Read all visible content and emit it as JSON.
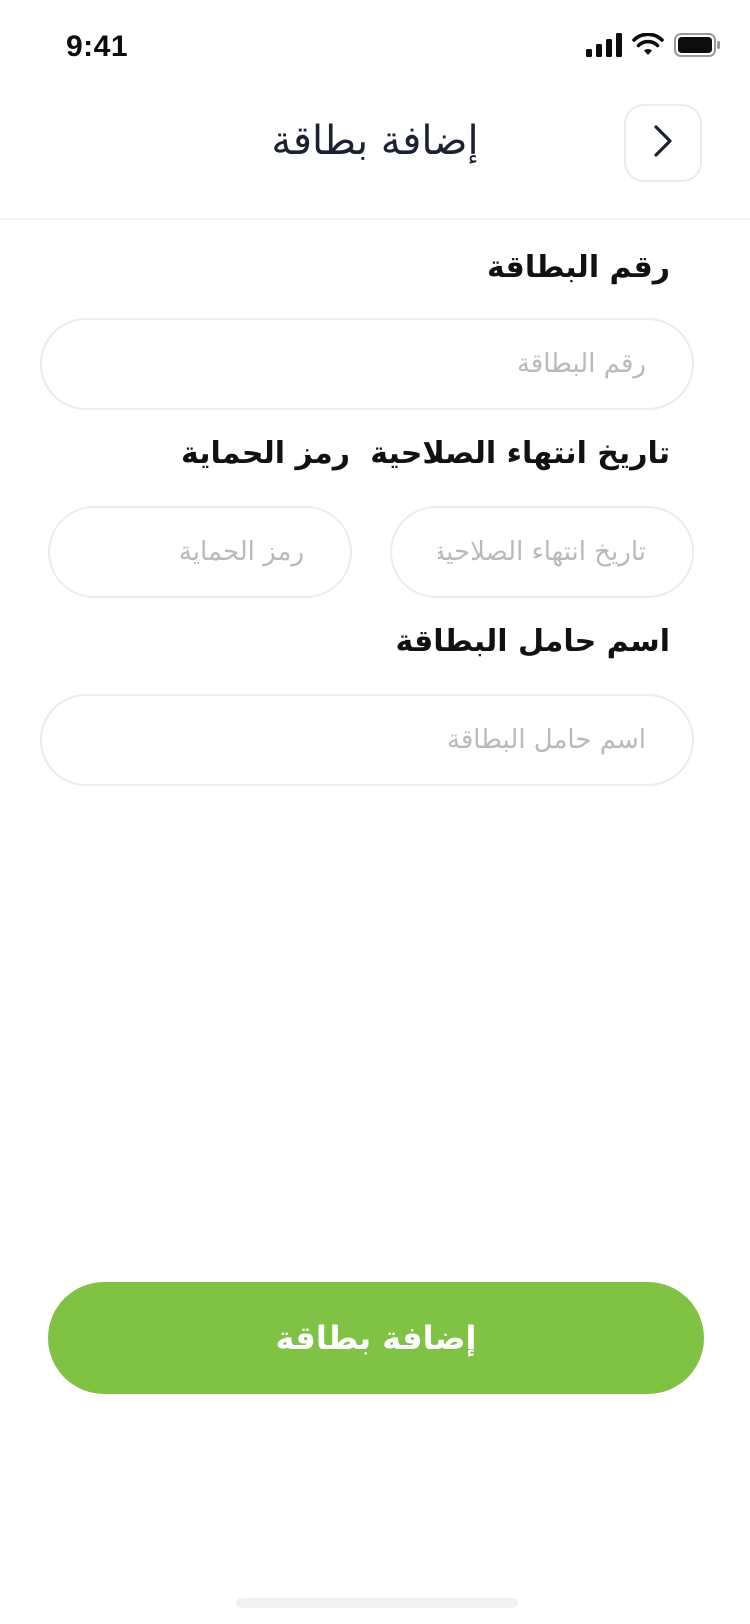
{
  "status_bar": {
    "time": "9:41",
    "icons": [
      "signal-icon",
      "wifi-icon",
      "battery-icon"
    ]
  },
  "header": {
    "title": "إضافة بطاقة",
    "back_icon": "chevron-right-icon"
  },
  "form": {
    "card_number": {
      "label": "رقم البطاقة",
      "placeholder": "رقم البطاقة",
      "value": ""
    },
    "expiry_date": {
      "label": "تاريخ انتهاء الصلاحية",
      "placeholder": "تاريخ انتهاء الصلاحية",
      "value": ""
    },
    "security_code": {
      "label": "رمز الحماية",
      "placeholder": "رمز الحماية",
      "value": ""
    },
    "card_holder": {
      "label": "اسم حامل البطاقة",
      "placeholder": "اسم حامل البطاقة",
      "value": ""
    }
  },
  "submit": {
    "label": "إضافة بطاقة"
  },
  "colors": {
    "accent": "#80c243",
    "input_border": "#ececec",
    "placeholder": "#b9b9b9",
    "title": "#1b2130"
  }
}
